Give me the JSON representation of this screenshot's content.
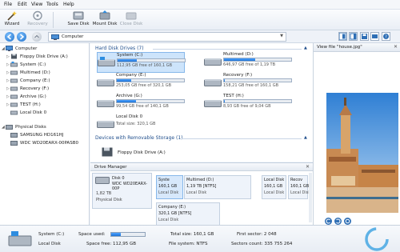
{
  "menu": [
    "File",
    "Edit",
    "View",
    "Tools",
    "Help"
  ],
  "toolbar": {
    "wizard": "Wizard",
    "recovery": "Recovery",
    "save_disk": "Save Disk",
    "mount_disk": "Mount Disk",
    "close_disk": "Close Disk"
  },
  "address": {
    "value": "Computer"
  },
  "tree": {
    "computer": "Computer",
    "items": [
      "Floppy Disk Drive (A:)",
      "System (C:)",
      "Multimed (D:)",
      "Company (E:)",
      "Recovery (F:)",
      "Archive (G:)",
      "TEST (H:)",
      "Local Disk 0"
    ],
    "physical": "Physical Disks",
    "disks": [
      "SAMSUNG HD161HJ",
      "WDC WD20EARX-00PASB0"
    ]
  },
  "hard_disk_drives": {
    "title": "Hard Disk Drives (7)",
    "drives": [
      {
        "name": "System (C:)",
        "free": "112,95 GB free of 160,1 GB",
        "used_pct": 29
      },
      {
        "name": "Multimed (D:)",
        "free": "646,97 GB free of 1,19 TB",
        "used_pct": 47
      },
      {
        "name": "Company (E:)",
        "free": "253,05 GB free of 320,1 GB",
        "used_pct": 21
      },
      {
        "name": "Recovery (F:)",
        "free": "158,21 GB free of 160,1 GB",
        "used_pct": 1
      },
      {
        "name": "Archive (G:)",
        "free": "99,54 GB free of 140,1 GB",
        "used_pct": 29
      },
      {
        "name": "TEST (H:)",
        "free": "8,93 GB free of 9,04 GB",
        "used_pct": 1
      },
      {
        "name": "Local Disk 0",
        "free": "Total size: 320,1 GB"
      }
    ]
  },
  "removable": {
    "title": "Devices with Removable Storage (1)",
    "drives": [
      {
        "name": "Floppy Disk Drive (A:)"
      }
    ]
  },
  "drive_manager": {
    "title": "Drive Manager",
    "disk": {
      "name": "Disk 0",
      "model": "WDC WD20EARX-00P",
      "size": "1,82 TB",
      "type": "Physical Disk"
    },
    "partitions": [
      {
        "name": "Syste",
        "size": "160,1 GB",
        "type": "Local Disk"
      },
      {
        "name": "Multimed (D:)",
        "size": "1,19 TB [NTFS]",
        "type": "Local Disk"
      },
      {
        "name": "Local Disk",
        "size": "160,1 GB",
        "type": "Local Disk"
      },
      {
        "name": "Recov",
        "size": "160,1 GB",
        "type": "Local Disk"
      },
      {
        "name": "Company (E:)",
        "size": "320,1 GB [NTFS]",
        "type": "Local Disk"
      }
    ]
  },
  "preview": {
    "title": "View file \"house.jpg\""
  },
  "status": {
    "name": "System (C:)",
    "type": "Local Disk",
    "space_used_label": "Space used:",
    "space_free": "Space free: 112,95 GB",
    "total_size": "Total size: 160,1 GB",
    "file_system": "File system: NTFS",
    "first_sector": "First sector: 2 048",
    "sectors_count": "Sectors count: 335 755 264",
    "used_pct": 29
  }
}
